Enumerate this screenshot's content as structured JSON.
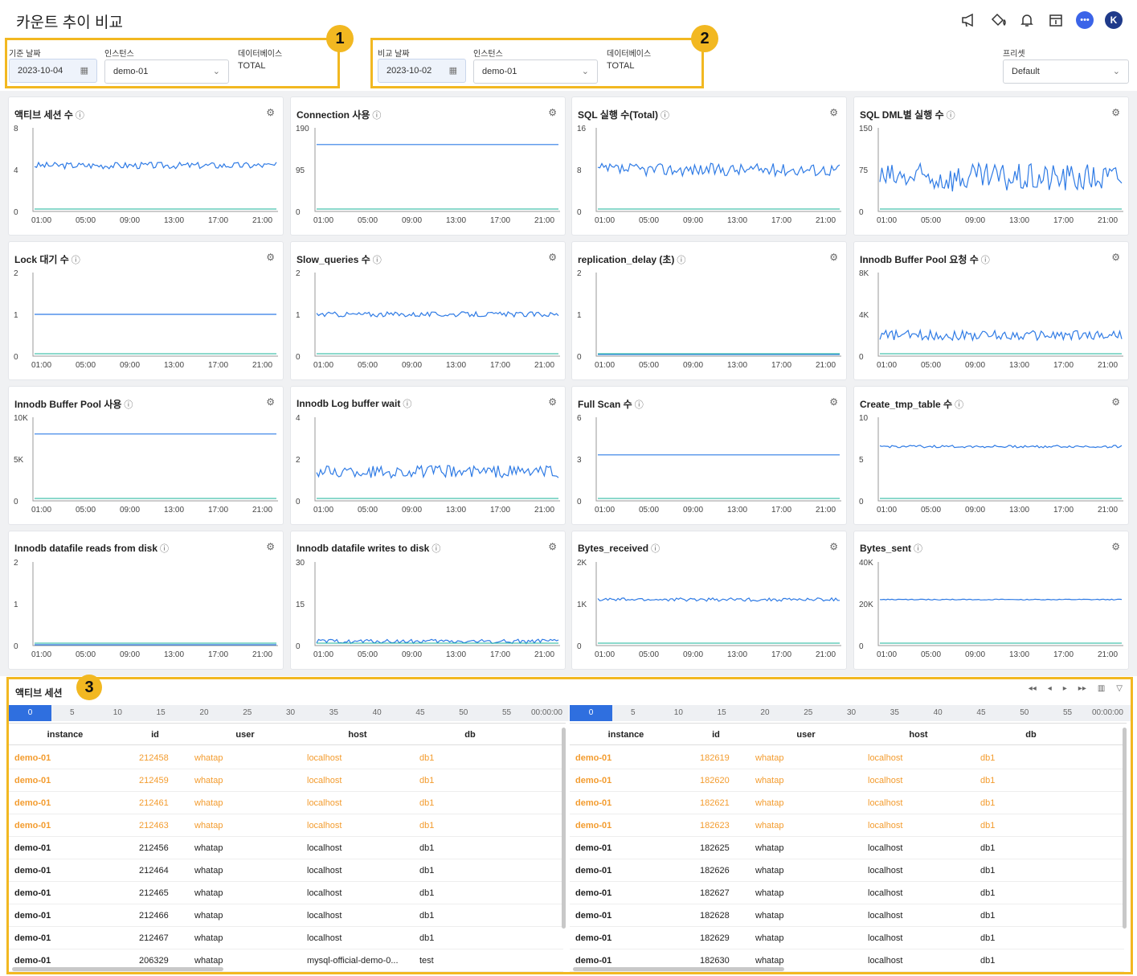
{
  "page_title": "카운트 추이 비교",
  "header_icons": [
    "megaphone-icon",
    "paint-bucket-icon",
    "bell-icon",
    "calendar-icon",
    "chat-icon",
    "user-avatar"
  ],
  "avatar_letter": "K",
  "filters": {
    "base": {
      "badge": "1",
      "date_label": "기준 날짜",
      "date_value": "2023-10-04",
      "instance_label": "인스턴스",
      "instance_value": "demo-01",
      "db_label": "데이터베이스",
      "db_value": "TOTAL"
    },
    "compare": {
      "badge": "2",
      "date_label": "비교 날짜",
      "date_value": "2023-10-02",
      "instance_label": "인스턴스",
      "instance_value": "demo-01",
      "db_label": "데이터베이스",
      "db_value": "TOTAL"
    },
    "preset": {
      "label": "프리셋",
      "value": "Default"
    }
  },
  "panels": [
    {
      "title": "액티브 세션 수",
      "y_ticks": [
        "8",
        "4",
        "0"
      ],
      "x_ticks": [
        "01:00",
        "05:00",
        "09:00",
        "13:00",
        "17:00",
        "21:00"
      ]
    },
    {
      "title": "Connection 사용",
      "y_ticks": [
        "190",
        "95",
        "0"
      ],
      "x_ticks": [
        "01:00",
        "05:00",
        "09:00",
        "13:00",
        "17:00",
        "21:00"
      ]
    },
    {
      "title": "SQL 실행 수(Total)",
      "y_ticks": [
        "16",
        "8",
        "0"
      ],
      "x_ticks": [
        "01:00",
        "05:00",
        "09:00",
        "13:00",
        "17:00",
        "21:00"
      ]
    },
    {
      "title": "SQL DML별 실행 수",
      "y_ticks": [
        "150",
        "75",
        "0"
      ],
      "x_ticks": [
        "01:00",
        "05:00",
        "09:00",
        "13:00",
        "17:00",
        "21:00"
      ]
    },
    {
      "title": "Lock 대기 수",
      "y_ticks": [
        "2",
        "1",
        "0"
      ],
      "x_ticks": [
        "01:00",
        "05:00",
        "09:00",
        "13:00",
        "17:00",
        "21:00"
      ]
    },
    {
      "title": "Slow_queries 수",
      "y_ticks": [
        "2",
        "1",
        "0"
      ],
      "x_ticks": [
        "01:00",
        "05:00",
        "09:00",
        "13:00",
        "17:00",
        "21:00"
      ]
    },
    {
      "title": "replication_delay (초)",
      "y_ticks": [
        "2",
        "1",
        "0"
      ],
      "x_ticks": [
        "01:00",
        "05:00",
        "09:00",
        "13:00",
        "17:00",
        "21:00"
      ]
    },
    {
      "title": "Innodb Buffer Pool 요청 수",
      "y_ticks": [
        "8K",
        "4K",
        "0"
      ],
      "x_ticks": [
        "01:00",
        "05:00",
        "09:00",
        "13:00",
        "17:00",
        "21:00"
      ]
    },
    {
      "title": "Innodb Buffer Pool 사용",
      "y_ticks": [
        "10K",
        "5K",
        "0"
      ],
      "x_ticks": [
        "01:00",
        "05:00",
        "09:00",
        "13:00",
        "17:00",
        "21:00"
      ]
    },
    {
      "title": "Innodb Log buffer wait",
      "y_ticks": [
        "4",
        "2",
        "0"
      ],
      "x_ticks": [
        "01:00",
        "05:00",
        "09:00",
        "13:00",
        "17:00",
        "21:00"
      ]
    },
    {
      "title": "Full Scan 수",
      "y_ticks": [
        "6",
        "3",
        "0"
      ],
      "x_ticks": [
        "01:00",
        "05:00",
        "09:00",
        "13:00",
        "17:00",
        "21:00"
      ]
    },
    {
      "title": "Create_tmp_table 수",
      "y_ticks": [
        "10",
        "5",
        "0"
      ],
      "x_ticks": [
        "01:00",
        "05:00",
        "09:00",
        "13:00",
        "17:00",
        "21:00"
      ]
    },
    {
      "title": "Innodb datafile reads from disk",
      "y_ticks": [
        "2",
        "1",
        "0"
      ],
      "x_ticks": [
        "01:00",
        "05:00",
        "09:00",
        "13:00",
        "17:00",
        "21:00"
      ]
    },
    {
      "title": "Innodb datafile writes to disk",
      "y_ticks": [
        "30",
        "15",
        "0"
      ],
      "x_ticks": [
        "01:00",
        "05:00",
        "09:00",
        "13:00",
        "17:00",
        "21:00"
      ]
    },
    {
      "title": "Bytes_received",
      "y_ticks": [
        "2K",
        "1K",
        "0"
      ],
      "x_ticks": [
        "01:00",
        "05:00",
        "09:00",
        "13:00",
        "17:00",
        "21:00"
      ]
    },
    {
      "title": "Bytes_sent",
      "y_ticks": [
        "40K",
        "20K",
        "0"
      ],
      "x_ticks": [
        "01:00",
        "05:00",
        "09:00",
        "13:00",
        "17:00",
        "21:00"
      ]
    }
  ],
  "bottom": {
    "badge": "3",
    "title": "액티브 세션",
    "timeline_ticks": [
      "0",
      "5",
      "10",
      "15",
      "20",
      "25",
      "30",
      "35",
      "40",
      "45",
      "50",
      "55",
      "00:00:00"
    ],
    "columns": [
      "instance",
      "id",
      "user",
      "host",
      "db"
    ],
    "left_rows": [
      {
        "instance": "demo-01",
        "id": "212458",
        "user": "whatap",
        "host": "localhost",
        "db": "db1",
        "highlight": true
      },
      {
        "instance": "demo-01",
        "id": "212459",
        "user": "whatap",
        "host": "localhost",
        "db": "db1",
        "highlight": true
      },
      {
        "instance": "demo-01",
        "id": "212461",
        "user": "whatap",
        "host": "localhost",
        "db": "db1",
        "highlight": true
      },
      {
        "instance": "demo-01",
        "id": "212463",
        "user": "whatap",
        "host": "localhost",
        "db": "db1",
        "highlight": true
      },
      {
        "instance": "demo-01",
        "id": "212456",
        "user": "whatap",
        "host": "localhost",
        "db": "db1",
        "highlight": false
      },
      {
        "instance": "demo-01",
        "id": "212464",
        "user": "whatap",
        "host": "localhost",
        "db": "db1",
        "highlight": false
      },
      {
        "instance": "demo-01",
        "id": "212465",
        "user": "whatap",
        "host": "localhost",
        "db": "db1",
        "highlight": false
      },
      {
        "instance": "demo-01",
        "id": "212466",
        "user": "whatap",
        "host": "localhost",
        "db": "db1",
        "highlight": false
      },
      {
        "instance": "demo-01",
        "id": "212467",
        "user": "whatap",
        "host": "localhost",
        "db": "db1",
        "highlight": false
      },
      {
        "instance": "demo-01",
        "id": "206329",
        "user": "whatap",
        "host": "mysql-official-demo-0...",
        "db": "test",
        "highlight": false
      }
    ],
    "right_rows": [
      {
        "instance": "demo-01",
        "id": "182619",
        "user": "whatap",
        "host": "localhost",
        "db": "db1",
        "highlight": true
      },
      {
        "instance": "demo-01",
        "id": "182620",
        "user": "whatap",
        "host": "localhost",
        "db": "db1",
        "highlight": true
      },
      {
        "instance": "demo-01",
        "id": "182621",
        "user": "whatap",
        "host": "localhost",
        "db": "db1",
        "highlight": true
      },
      {
        "instance": "demo-01",
        "id": "182623",
        "user": "whatap",
        "host": "localhost",
        "db": "db1",
        "highlight": true
      },
      {
        "instance": "demo-01",
        "id": "182625",
        "user": "whatap",
        "host": "localhost",
        "db": "db1",
        "highlight": false
      },
      {
        "instance": "demo-01",
        "id": "182626",
        "user": "whatap",
        "host": "localhost",
        "db": "db1",
        "highlight": false
      },
      {
        "instance": "demo-01",
        "id": "182627",
        "user": "whatap",
        "host": "localhost",
        "db": "db1",
        "highlight": false
      },
      {
        "instance": "demo-01",
        "id": "182628",
        "user": "whatap",
        "host": "localhost",
        "db": "db1",
        "highlight": false
      },
      {
        "instance": "demo-01",
        "id": "182629",
        "user": "whatap",
        "host": "localhost",
        "db": "db1",
        "highlight": false
      },
      {
        "instance": "demo-01",
        "id": "182630",
        "user": "whatap",
        "host": "localhost",
        "db": "db1",
        "highlight": false
      }
    ]
  },
  "colors": {
    "accent": "#f2b821",
    "series_blue": "#2f7be5",
    "series_teal": "#19b39a",
    "series_lilac": "#c9a6e8",
    "warn_text": "#f39c2f",
    "orange": "#f08a4b"
  }
}
